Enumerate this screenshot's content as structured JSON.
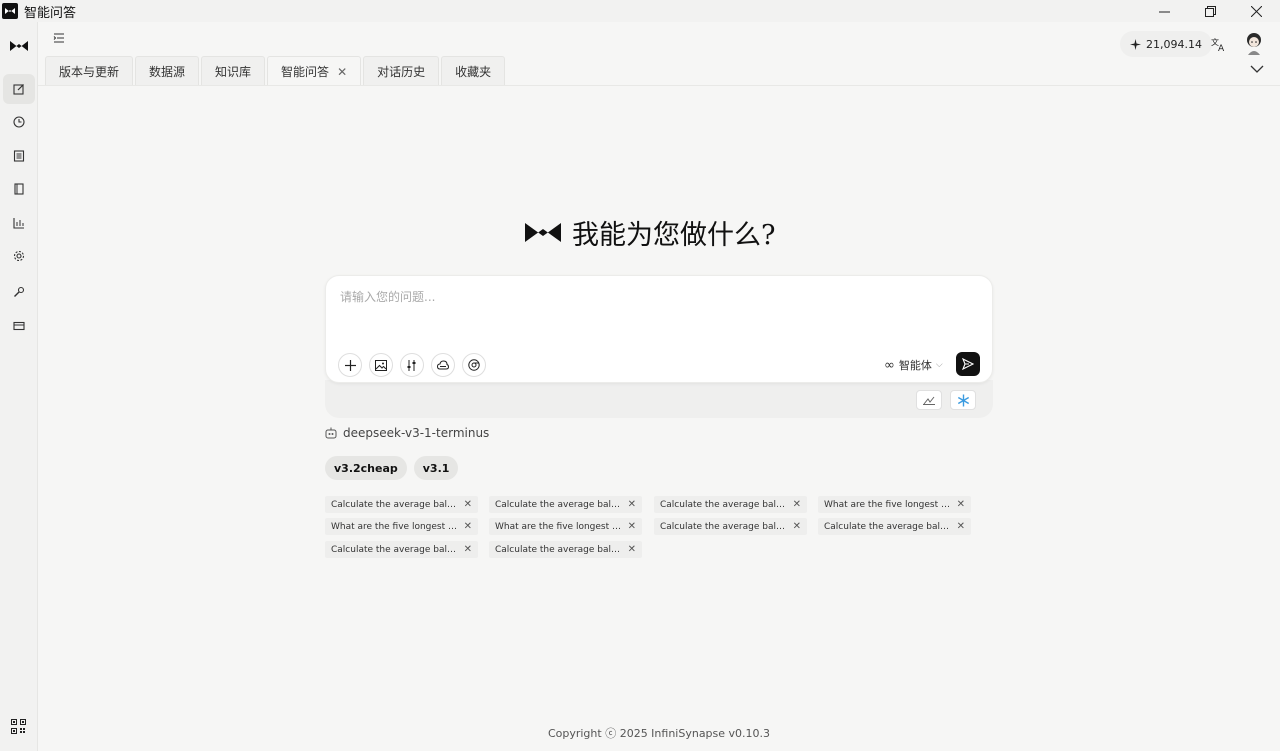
{
  "window": {
    "title": "智能问答",
    "controls": [
      "minimize-icon",
      "restore-icon",
      "close-icon"
    ]
  },
  "sidebar": {
    "items": [
      {
        "name": "new-chat",
        "icon": "edit-icon",
        "active": true
      },
      {
        "name": "history",
        "icon": "clock-icon"
      },
      {
        "name": "database",
        "icon": "list-icon"
      },
      {
        "name": "knowledge",
        "icon": "book-icon"
      },
      {
        "name": "analytics",
        "icon": "chart-icon"
      },
      {
        "name": "settings",
        "icon": "gear-icon"
      },
      {
        "name": "tools",
        "icon": "wrench-icon"
      },
      {
        "name": "billing",
        "icon": "card-icon"
      }
    ]
  },
  "header": {
    "score": "21,094.14"
  },
  "tabs": [
    {
      "label": "版本与更新"
    },
    {
      "label": "数据源"
    },
    {
      "label": "知识库"
    },
    {
      "label": "智能问答",
      "active": true,
      "closable": true
    },
    {
      "label": "对话历史"
    },
    {
      "label": "收藏夹"
    }
  ],
  "main": {
    "hero_title": "我能为您做什么?",
    "input_placeholder": "请输入您的问题...",
    "agent_label": "智能体",
    "model_name": "deepseek-v3-1-terminus",
    "model_chips": [
      "v3.2cheap",
      "v3.1"
    ],
    "history_items": [
      "Calculate the average balance...",
      "Calculate the average balance...",
      "Calculate the average balance...",
      "What are the five longest typ...",
      "What are the five longest typ...",
      "What are the five longest typ...",
      "Calculate the average balance...",
      "Calculate the average balance...",
      "Calculate the average balance...",
      "Calculate the average balance..."
    ]
  },
  "footer": {
    "copyright": "Copyright ⓒ 2025 InfiniSynapse v0.10.3"
  },
  "colors": {
    "accent_dark": "#111111",
    "snowflake": "#3a9be0",
    "background": "#f6f6f5"
  }
}
